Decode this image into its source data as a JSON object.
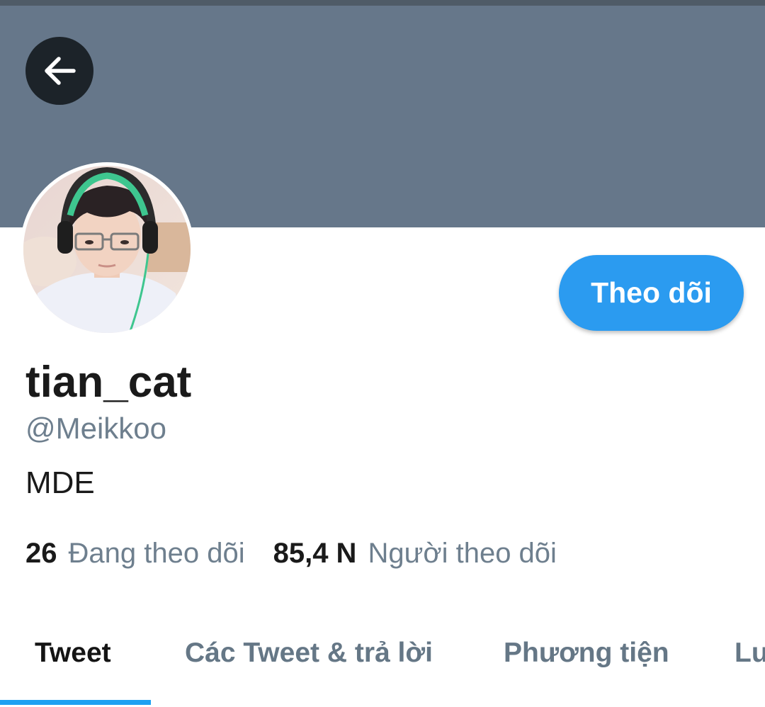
{
  "header": {
    "back_icon": "arrow-left-icon",
    "banner_color": "#66778a"
  },
  "profile": {
    "avatar_icon": "avatar-photo",
    "display_name": "tian_cat",
    "handle": "@Meikkoo",
    "bio": "MDE",
    "follow_label": "Theo dõi",
    "accent_color": "#2b9bf0"
  },
  "stats": {
    "following_count": "26",
    "following_label": "Đang theo dõi",
    "followers_count": "85,4 N",
    "followers_label": "Người theo dõi"
  },
  "tabs": [
    {
      "label": "Tweet",
      "active": true
    },
    {
      "label": "Các Tweet & trả lời",
      "active": false
    },
    {
      "label": "Phương tiện",
      "active": false
    },
    {
      "label": "Lượt thích",
      "active": false
    }
  ]
}
